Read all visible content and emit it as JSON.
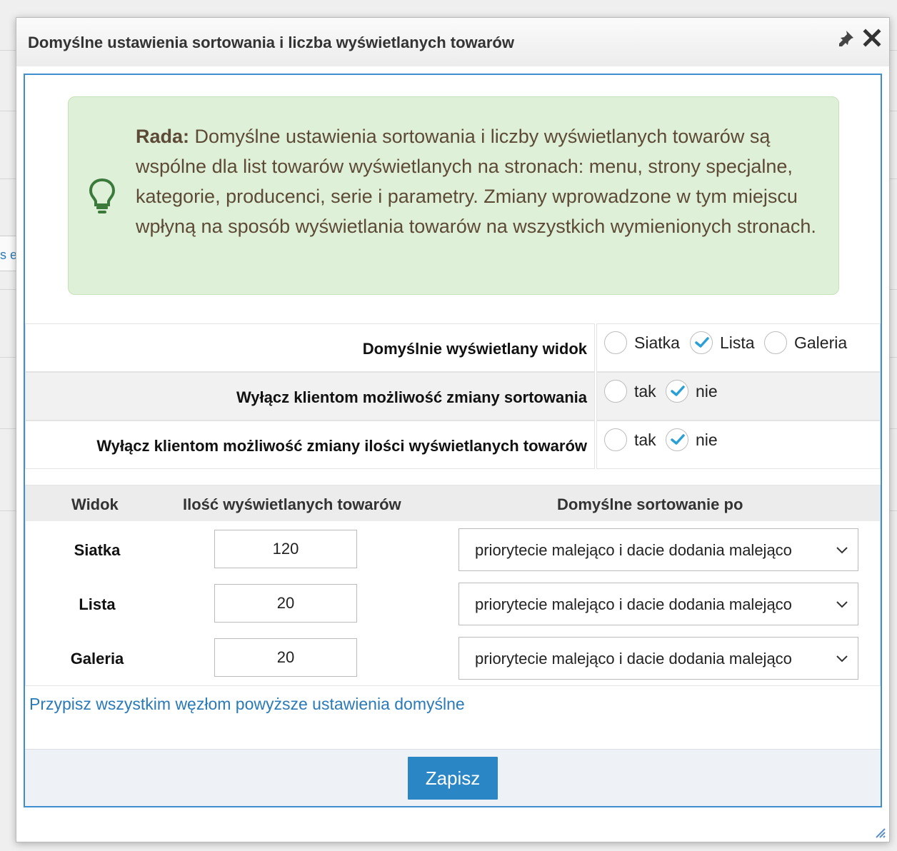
{
  "dialog": {
    "title": "Domyślne ustawienia sortowania i liczba wyświetlanych towarów",
    "background_fragment": "s e"
  },
  "hint": {
    "label": "Rada:",
    "text": " Domyślne ustawienia sortowania i liczby wyświetlanych towarów są wspólne dla list towarów wyświetlanych na stronach: menu, strony specjalne, kategorie, producenci, serie i parametry. Zmiany wprowadzone w tym miejscu wpłyną na sposób wyświetlania towarów na wszystkich wymienionych stronach."
  },
  "settings": {
    "default_view": {
      "label": "Domyślnie wyświetlany widok",
      "options": [
        {
          "label": "Siatka",
          "checked": false
        },
        {
          "label": "Lista",
          "checked": true
        },
        {
          "label": "Galeria",
          "checked": false
        }
      ]
    },
    "disable_sort_change": {
      "label": "Wyłącz klientom możliwość zmiany sortowania",
      "options": [
        {
          "label": "tak",
          "checked": false
        },
        {
          "label": "nie",
          "checked": true
        }
      ]
    },
    "disable_count_change": {
      "label": "Wyłącz klientom możliwość zmiany ilości wyświetlanych towarów",
      "options": [
        {
          "label": "tak",
          "checked": false
        },
        {
          "label": "nie",
          "checked": true
        }
      ]
    }
  },
  "table": {
    "headers": [
      "Widok",
      "Ilość wyświetlanych towarów",
      "Domyślne sortowanie po"
    ],
    "rows": [
      {
        "view": "Siatka",
        "count": "120",
        "sort": "priorytecie malejąco i dacie dodania malejąco"
      },
      {
        "view": "Lista",
        "count": "20",
        "sort": "priorytecie malejąco i dacie dodania malejąco"
      },
      {
        "view": "Galeria",
        "count": "20",
        "sort": "priorytecie malejąco i dacie dodania malejąco"
      }
    ]
  },
  "assign_link": "Przypisz wszystkim węzłom powyższe ustawienia domyślne",
  "save_button": "Zapisz",
  "colors": {
    "accent": "#2b86c5",
    "link": "#2a7ab8",
    "check": "#2a9fd6",
    "hint_bg": "#dff0d8",
    "hint_icon": "#3c7a3c",
    "hint_text": "#5d4a36"
  },
  "icons": {
    "pin": "pin-icon",
    "close": "close-icon",
    "hint": "lightbulb-icon",
    "select": "chevron-down-icon",
    "check": "checkmark-icon",
    "resize": "resize-grip-icon"
  }
}
